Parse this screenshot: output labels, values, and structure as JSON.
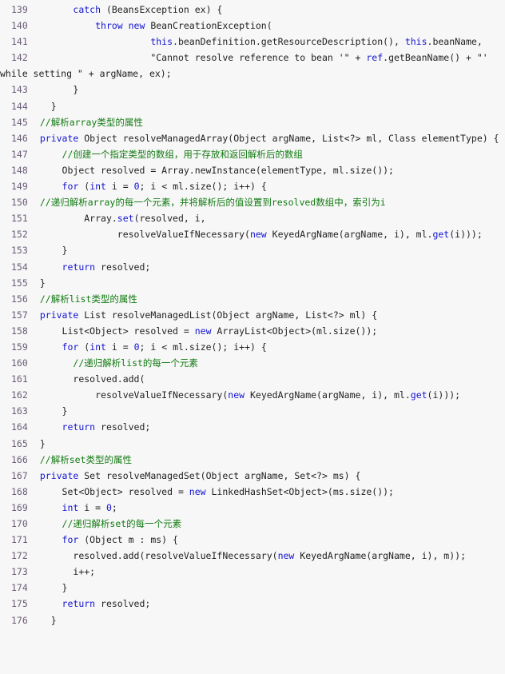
{
  "viewer": {
    "name": "code-listing",
    "language": "java",
    "background_color": "#f7f7f7",
    "gutter_color": "#6c5b78",
    "keyword_color": "#1414d2",
    "comment_color": "#127a12",
    "text_color": "#222222",
    "first_line_number": 139,
    "last_line_number": 176
  },
  "lines": [
    {
      "num": "139",
      "indent": 4,
      "tokens": [
        {
          "t": "kw",
          "v": "catch"
        },
        {
          "t": "plain",
          "v": " (BeansException ex) {"
        }
      ]
    },
    {
      "num": "140",
      "indent": 6,
      "tokens": [
        {
          "t": "kw",
          "v": "throw new"
        },
        {
          "t": "plain",
          "v": " BeanCreationException("
        }
      ]
    },
    {
      "num": "141",
      "indent": 11,
      "tokens": [
        {
          "t": "kw",
          "v": "this"
        },
        {
          "t": "plain",
          "v": ".beanDefinition.getResourceDescription(), "
        },
        {
          "t": "kw",
          "v": "this"
        },
        {
          "t": "plain",
          "v": ".beanName,"
        }
      ]
    },
    {
      "num": "142",
      "indent": 11,
      "tokens": [
        {
          "t": "str",
          "v": "\"Cannot resolve reference to bean '\""
        },
        {
          "t": "plain",
          "v": " + "
        },
        {
          "t": "meth",
          "v": "ref"
        },
        {
          "t": "plain",
          "v": ".getBeanName() + "
        },
        {
          "t": "str",
          "v": "\"' while setting \""
        },
        {
          "t": "plain",
          "v": " + argName, ex);"
        }
      ]
    },
    {
      "num": "143",
      "indent": 4,
      "tokens": [
        {
          "t": "plain",
          "v": "}"
        }
      ]
    },
    {
      "num": "144",
      "indent": 2,
      "tokens": [
        {
          "t": "plain",
          "v": "}"
        }
      ]
    },
    {
      "num": "145",
      "indent": 1,
      "tokens": [
        {
          "t": "cmt",
          "v": "//解析array类型的属性"
        }
      ]
    },
    {
      "num": "146",
      "indent": 1,
      "tokens": [
        {
          "t": "kw",
          "v": "private"
        },
        {
          "t": "plain",
          "v": " Object resolveManagedArray(Object argName, List<?> ml, Class elementType) {"
        }
      ]
    },
    {
      "num": "147",
      "indent": 3,
      "tokens": [
        {
          "t": "cmt",
          "v": "//创建一个指定类型的数组，用于存放和返回解析后的数组"
        }
      ]
    },
    {
      "num": "148",
      "indent": 3,
      "tokens": [
        {
          "t": "plain",
          "v": "Object resolved = Array.newInstance(elementType, ml.size());"
        }
      ]
    },
    {
      "num": "149",
      "indent": 3,
      "tokens": [
        {
          "t": "kw",
          "v": "for"
        },
        {
          "t": "plain",
          "v": " ("
        },
        {
          "t": "kw",
          "v": "int"
        },
        {
          "t": "plain",
          "v": " i = "
        },
        {
          "t": "num",
          "v": "0"
        },
        {
          "t": "plain",
          "v": "; i < ml.size(); i++) {"
        }
      ]
    },
    {
      "num": "150",
      "indent": 1,
      "tokens": [
        {
          "t": "cmt",
          "v": "//递归解析array的每一个元素，并将解析后的值设置到resolved数组中，索引为i"
        }
      ]
    },
    {
      "num": "151",
      "indent": 5,
      "tokens": [
        {
          "t": "plain",
          "v": "Array."
        },
        {
          "t": "meth",
          "v": "set"
        },
        {
          "t": "plain",
          "v": "(resolved, i,"
        }
      ]
    },
    {
      "num": "152",
      "indent": 8,
      "tokens": [
        {
          "t": "plain",
          "v": "resolveValueIfNecessary("
        },
        {
          "t": "kw",
          "v": "new"
        },
        {
          "t": "plain",
          "v": " KeyedArgName(argName, i), ml."
        },
        {
          "t": "meth",
          "v": "get"
        },
        {
          "t": "plain",
          "v": "(i)));"
        }
      ]
    },
    {
      "num": "153",
      "indent": 3,
      "tokens": [
        {
          "t": "plain",
          "v": "}"
        }
      ]
    },
    {
      "num": "154",
      "indent": 3,
      "tokens": [
        {
          "t": "kw",
          "v": "return"
        },
        {
          "t": "plain",
          "v": " resolved;"
        }
      ]
    },
    {
      "num": "155",
      "indent": 1,
      "tokens": [
        {
          "t": "plain",
          "v": "}"
        }
      ]
    },
    {
      "num": "156",
      "indent": 1,
      "tokens": [
        {
          "t": "cmt",
          "v": "//解析list类型的属性"
        }
      ]
    },
    {
      "num": "157",
      "indent": 1,
      "tokens": [
        {
          "t": "kw",
          "v": "private"
        },
        {
          "t": "plain",
          "v": " List resolveManagedList(Object argName, List<?> ml) {"
        }
      ]
    },
    {
      "num": "158",
      "indent": 3,
      "tokens": [
        {
          "t": "plain",
          "v": "List<Object> resolved = "
        },
        {
          "t": "kw",
          "v": "new"
        },
        {
          "t": "plain",
          "v": " ArrayList<Object>(ml.size());"
        }
      ]
    },
    {
      "num": "159",
      "indent": 3,
      "tokens": [
        {
          "t": "kw",
          "v": "for"
        },
        {
          "t": "plain",
          "v": " ("
        },
        {
          "t": "kw",
          "v": "int"
        },
        {
          "t": "plain",
          "v": " i = "
        },
        {
          "t": "num",
          "v": "0"
        },
        {
          "t": "plain",
          "v": "; i < ml.size(); i++) {"
        }
      ]
    },
    {
      "num": "160",
      "indent": 4,
      "tokens": [
        {
          "t": "cmt",
          "v": "//递归解析list的每一个元素"
        }
      ]
    },
    {
      "num": "161",
      "indent": 4,
      "tokens": [
        {
          "t": "plain",
          "v": "resolved.add("
        }
      ]
    },
    {
      "num": "162",
      "indent": 6,
      "tokens": [
        {
          "t": "plain",
          "v": "resolveValueIfNecessary("
        },
        {
          "t": "kw",
          "v": "new"
        },
        {
          "t": "plain",
          "v": " KeyedArgName(argName, i), ml."
        },
        {
          "t": "meth",
          "v": "get"
        },
        {
          "t": "plain",
          "v": "(i)));"
        }
      ]
    },
    {
      "num": "163",
      "indent": 3,
      "tokens": [
        {
          "t": "plain",
          "v": "}"
        }
      ]
    },
    {
      "num": "164",
      "indent": 3,
      "tokens": [
        {
          "t": "kw",
          "v": "return"
        },
        {
          "t": "plain",
          "v": " resolved;"
        }
      ]
    },
    {
      "num": "165",
      "indent": 1,
      "tokens": [
        {
          "t": "plain",
          "v": "}"
        }
      ]
    },
    {
      "num": "166",
      "indent": 1,
      "tokens": [
        {
          "t": "cmt",
          "v": "//解析set类型的属性"
        }
      ]
    },
    {
      "num": "167",
      "indent": 1,
      "tokens": [
        {
          "t": "kw",
          "v": "private"
        },
        {
          "t": "plain",
          "v": " Set resolveManagedSet(Object argName, Set<?> ms) {"
        }
      ]
    },
    {
      "num": "168",
      "indent": 3,
      "tokens": [
        {
          "t": "plain",
          "v": "Set<Object> resolved = "
        },
        {
          "t": "kw",
          "v": "new"
        },
        {
          "t": "plain",
          "v": " LinkedHashSet<Object>(ms.size());"
        }
      ]
    },
    {
      "num": "169",
      "indent": 3,
      "tokens": [
        {
          "t": "kw",
          "v": "int"
        },
        {
          "t": "plain",
          "v": " i = "
        },
        {
          "t": "num",
          "v": "0"
        },
        {
          "t": "plain",
          "v": ";"
        }
      ]
    },
    {
      "num": "170",
      "indent": 3,
      "tokens": [
        {
          "t": "cmt",
          "v": "//递归解析set的每一个元素"
        }
      ]
    },
    {
      "num": "171",
      "indent": 3,
      "tokens": [
        {
          "t": "kw",
          "v": "for"
        },
        {
          "t": "plain",
          "v": " (Object m : ms) {"
        }
      ]
    },
    {
      "num": "172",
      "indent": 4,
      "tokens": [
        {
          "t": "plain",
          "v": "resolved.add(resolveValueIfNecessary("
        },
        {
          "t": "kw",
          "v": "new"
        },
        {
          "t": "plain",
          "v": " KeyedArgName(argName, i), m));"
        }
      ]
    },
    {
      "num": "173",
      "indent": 4,
      "tokens": [
        {
          "t": "plain",
          "v": "i++;"
        }
      ]
    },
    {
      "num": "174",
      "indent": 3,
      "tokens": [
        {
          "t": "plain",
          "v": "}"
        }
      ]
    },
    {
      "num": "175",
      "indent": 3,
      "tokens": [
        {
          "t": "kw",
          "v": "return"
        },
        {
          "t": "plain",
          "v": " resolved;"
        }
      ]
    },
    {
      "num": "176",
      "indent": 2,
      "tokens": [
        {
          "t": "plain",
          "v": "}"
        }
      ]
    }
  ]
}
